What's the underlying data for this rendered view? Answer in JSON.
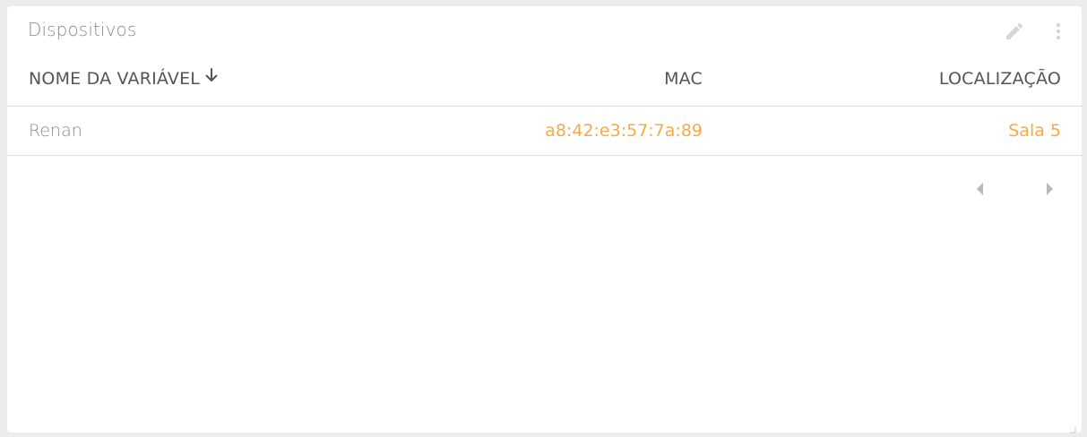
{
  "widget": {
    "title": "Dispositivos",
    "icons": {
      "edit": "pencil-icon",
      "menu": "more-vertical-icon"
    }
  },
  "table": {
    "columns": [
      {
        "label": "NOME DA VARIÁVEL",
        "sorted": "descending"
      },
      {
        "label": "MAC"
      },
      {
        "label": "LOCALIZAÇÃO"
      }
    ],
    "rows": [
      {
        "name": "Renan",
        "mac": "a8:42:e3:57:7a:89",
        "location": "Sala 5"
      }
    ]
  },
  "pagination": {
    "prev_icon": "caret-left-icon",
    "next_icon": "caret-right-icon"
  },
  "colors": {
    "accent": "#f5a94a",
    "heading": "#555555",
    "muted": "#8a8a8a",
    "icon": "#d6d6d6"
  }
}
